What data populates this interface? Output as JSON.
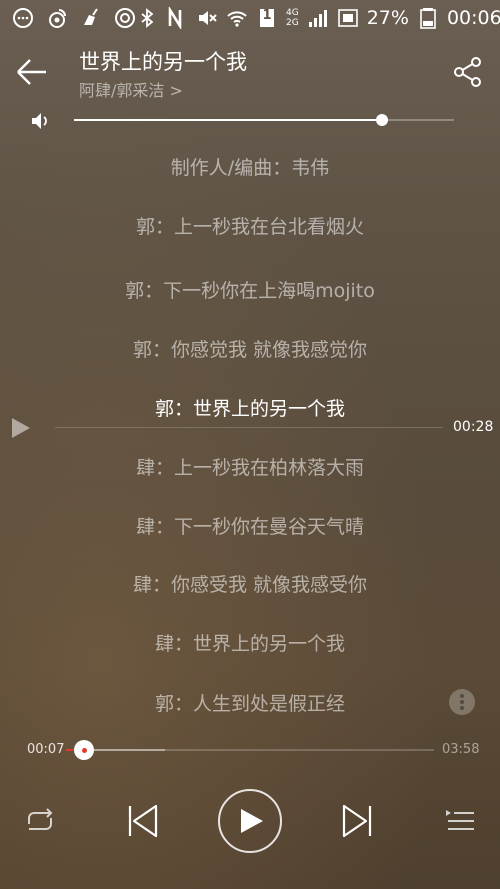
{
  "status_bar": {
    "battery_percent": "27%",
    "time": "00:06",
    "network_4g": "4G",
    "network_2g": "2G",
    "sim_label": "1"
  },
  "header": {
    "title": "世界上的另一个我",
    "artist": "阿肆/郭采洁 >"
  },
  "volume": {
    "level": 0.81
  },
  "lyrics": {
    "lines": [
      "制作人/编曲：韦伟",
      "郭：上一秒我在台北看烟火",
      "郭：下一秒你在上海喝mojito",
      "郭：你感觉我 就像我感觉你",
      "郭：世界上的另一个我",
      "肆：上一秒我在柏林落大雨",
      "肆：下一秒你在曼谷天气晴",
      "肆：你感受我 就像我感受你",
      "肆：世界上的另一个我",
      "郭：人生到处是假正经"
    ],
    "current_index": 4,
    "seek_time": "00:28"
  },
  "progress": {
    "current": "00:07",
    "total": "03:58",
    "played_fraction": 0.05,
    "buffered_fraction": 0.27
  },
  "controls": {
    "repeat": "repeat-icon",
    "previous": "skip-previous-icon",
    "play": "play-icon",
    "next": "skip-next-icon",
    "playlist": "playlist-icon"
  },
  "colors": {
    "accent": "#e03a2e",
    "text_primary": "#ffffff"
  }
}
